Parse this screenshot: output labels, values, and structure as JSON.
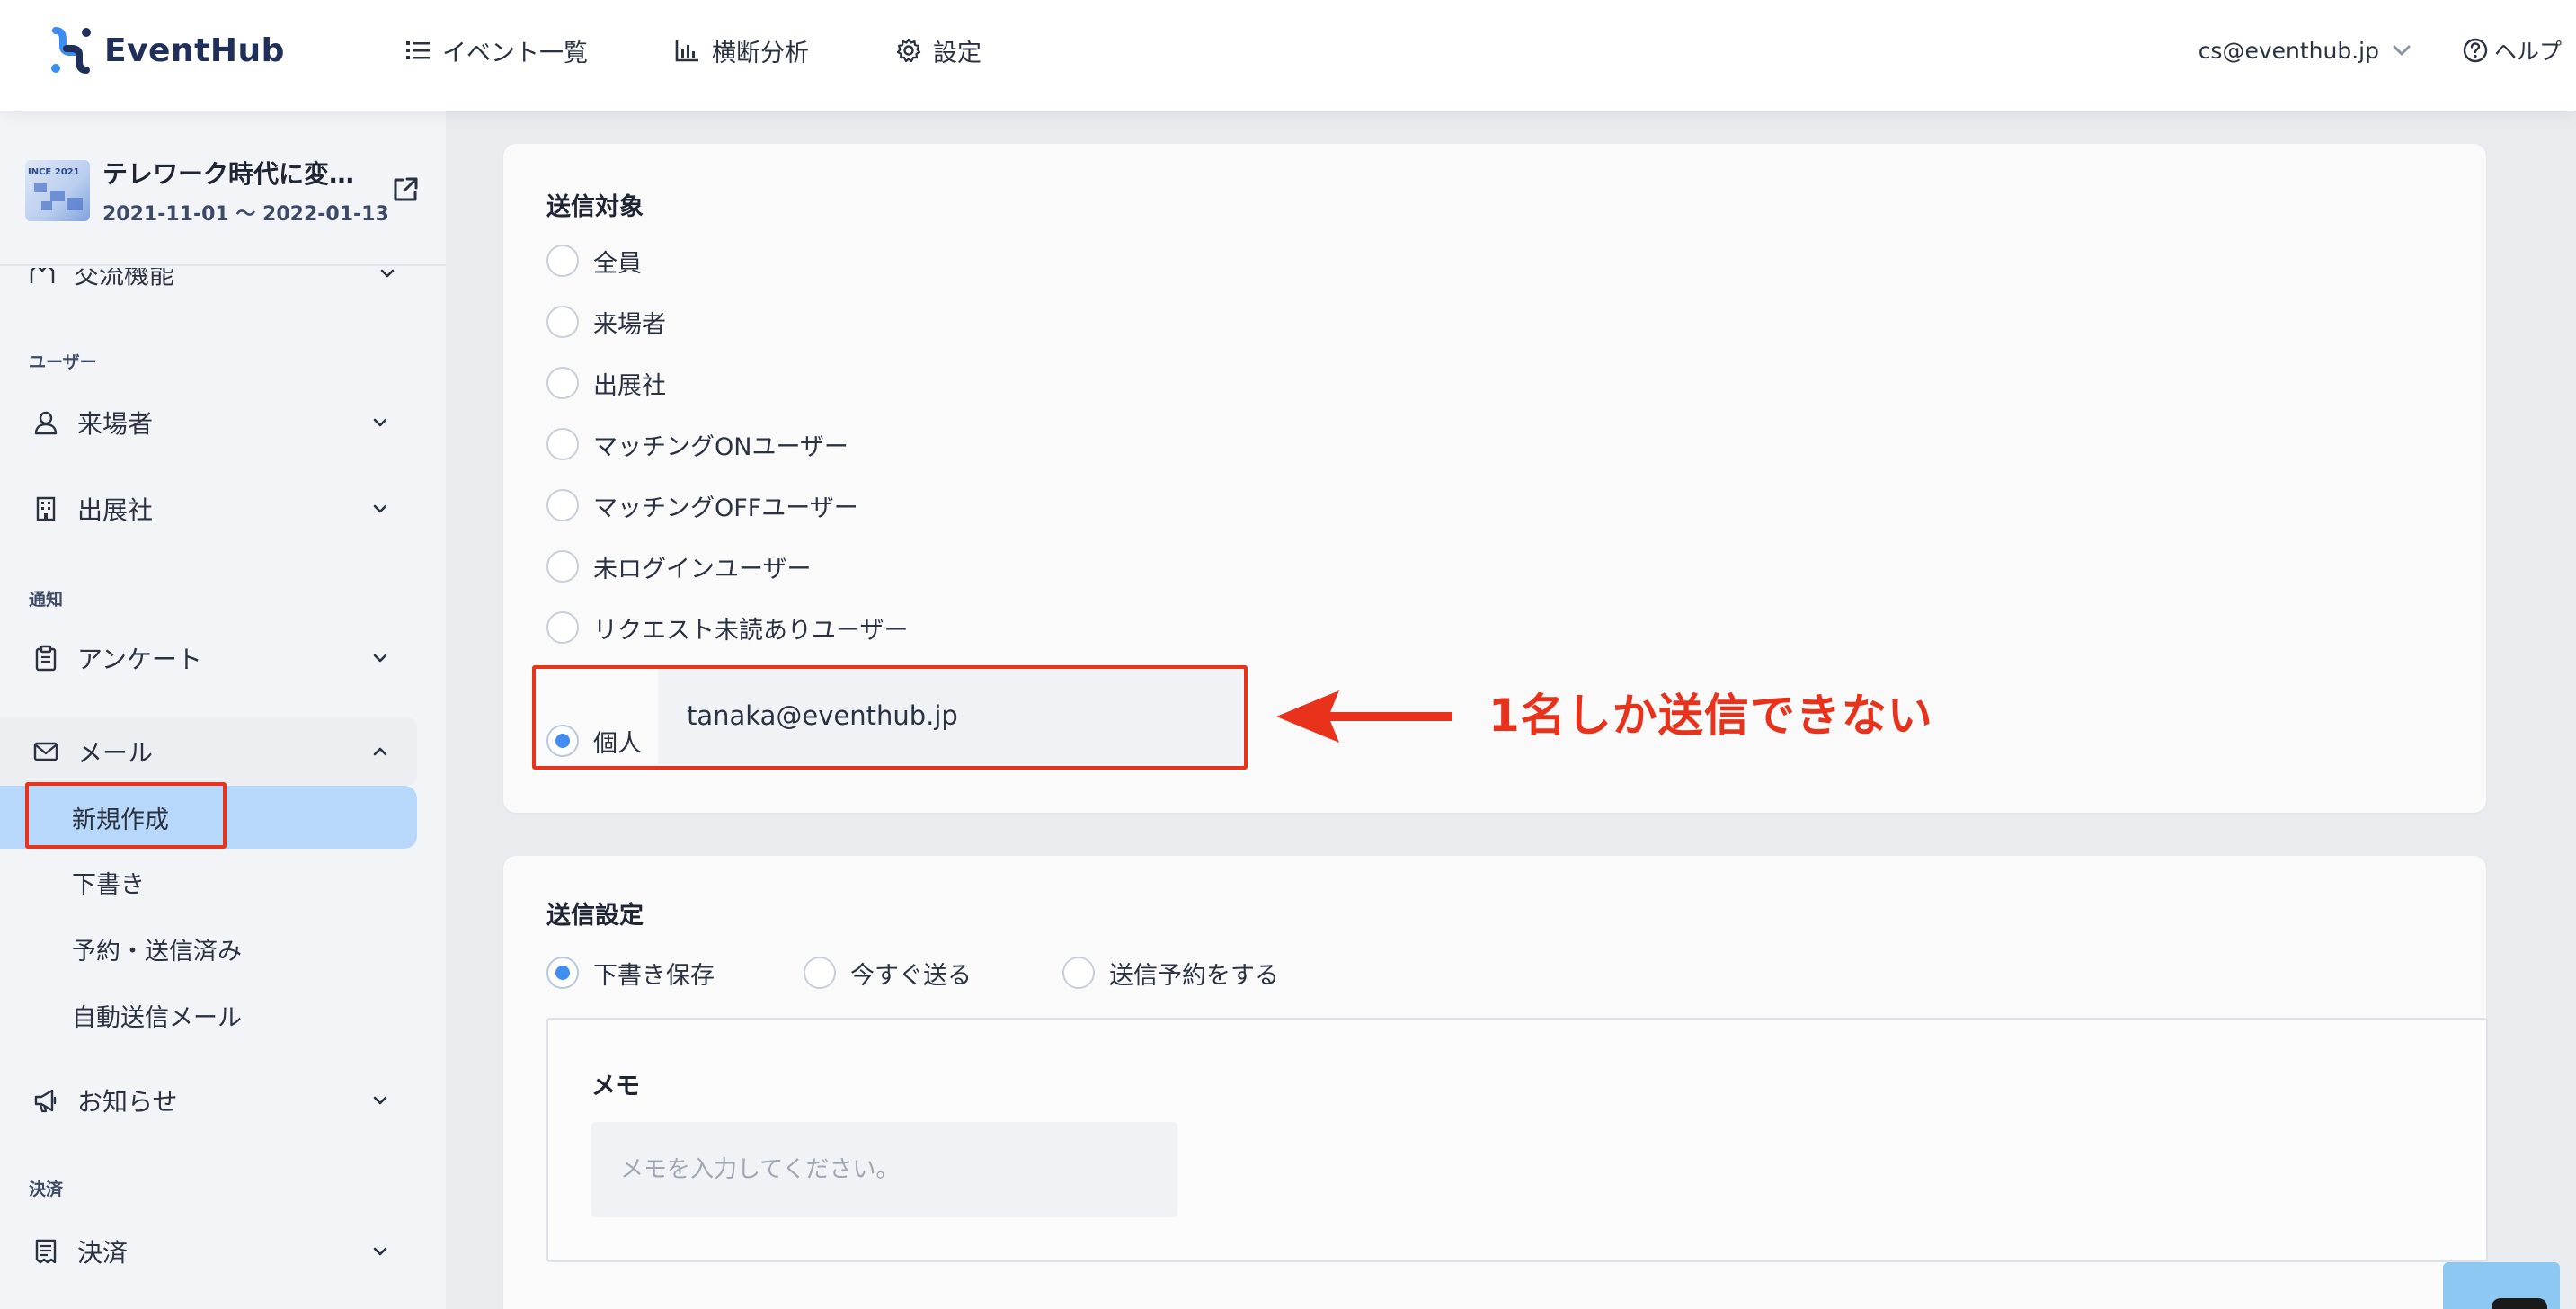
{
  "header": {
    "logo_text": "EventHub",
    "nav": [
      {
        "label": "イベント一覧",
        "icon": "list-icon"
      },
      {
        "label": "横断分析",
        "icon": "bar-chart-icon"
      },
      {
        "label": "設定",
        "icon": "gear-icon"
      }
    ],
    "account_email": "cs@eventhub.jp",
    "help_label": "ヘルプ"
  },
  "sidebar": {
    "event": {
      "thumb_text": "INCE 2021",
      "title": "テレワーク時代に変…",
      "dates": "2021-11-01 ～ 2022-01-13"
    },
    "cut_item_label": "交流機能",
    "sections": {
      "users": "ユーザー",
      "notifications": "通知",
      "payment": "決済"
    },
    "items": {
      "visitors": "来場者",
      "exhibitors": "出展社",
      "survey": "アンケート",
      "mail": "メール",
      "news": "お知らせ",
      "payment": "決済"
    },
    "mail_sub": {
      "new": "新規作成",
      "drafts": "下書き",
      "scheduled": "予約・送信済み",
      "auto": "自動送信メール"
    }
  },
  "recipients": {
    "title": "送信対象",
    "options": [
      "全員",
      "来場者",
      "出展社",
      "マッチングONユーザー",
      "マッチングOFFユーザー",
      "未ログインユーザー",
      "リクエスト未読ありユーザー"
    ],
    "individual_label": "個人",
    "individual_email": "tanaka@eventhub.jp",
    "selected": "個人"
  },
  "send_settings": {
    "title": "送信設定",
    "options": [
      "下書き保存",
      "今すぐ送る",
      "送信予約をする"
    ],
    "selected": "下書き保存",
    "memo_label": "メモ",
    "memo_placeholder": "メモを入力してください。"
  },
  "annotation": {
    "text": "1名しか送信できない",
    "color": "#e8321c"
  },
  "colors": {
    "accent": "#3f8ef0",
    "active_sub_bg": "#b8d8fb",
    "logo_blue": "#1f2f59"
  }
}
